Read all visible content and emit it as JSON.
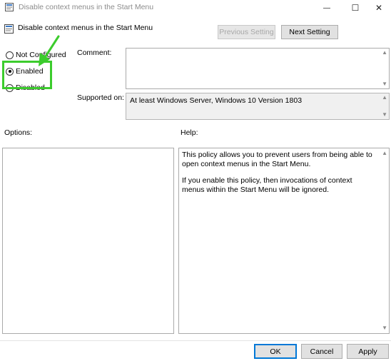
{
  "window": {
    "title": "Disable context menus in the Start Menu",
    "minimize_glyph": "—",
    "maximize_glyph": "☐",
    "close_glyph": "✕"
  },
  "header": {
    "policy_title": "Disable context menus in the Start Menu",
    "previous_label": "Previous Setting",
    "next_label": "Next Setting"
  },
  "state": {
    "options": [
      {
        "label": "Not Configured",
        "checked": false
      },
      {
        "label": "Enabled",
        "checked": true
      },
      {
        "label": "Disabled",
        "checked": false
      }
    ]
  },
  "comment": {
    "label": "Comment:",
    "value": ""
  },
  "supported": {
    "label": "Supported on:",
    "value": "At least Windows Server, Windows 10 Version 1803"
  },
  "options_panel": {
    "label": "Options:"
  },
  "help_panel": {
    "label": "Help:",
    "paragraphs": [
      "This policy allows you to prevent users from being able to open context menus in the Start Menu.",
      "If you enable this policy, then invocations of context menus within the Start Menu will be ignored."
    ]
  },
  "footer": {
    "ok_label": "OK",
    "cancel_label": "Cancel",
    "apply_label": "Apply"
  },
  "colors": {
    "annotation_green": "#3ccc2d",
    "default_button_border": "#0078d7"
  }
}
